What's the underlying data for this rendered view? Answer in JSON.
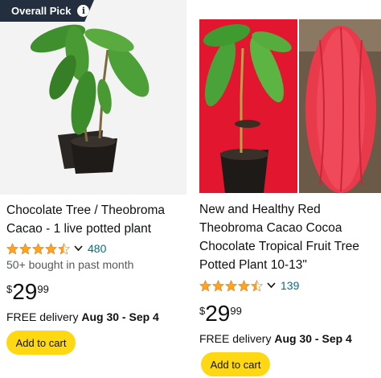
{
  "colors": {
    "badge_bg": "#232f3e",
    "star": "#ffa41c",
    "link": "#007185",
    "button": "#ffd814",
    "muted": "#565959"
  },
  "products": [
    {
      "badge": "Overall Pick",
      "badge_icon": "info-icon",
      "image_alt": "Theobroma cacao seedling in black pot",
      "title": "Chocolate Tree / Theobroma Cacao - 1 live potted plant",
      "rating": 4.5,
      "review_count": "480",
      "bought": "50+ bought in past month",
      "price_symbol": "$",
      "price_whole": "29",
      "price_fraction": "99",
      "delivery_prefix": "FREE delivery ",
      "delivery_dates": "Aug 30 - Sep 4",
      "cart_label": "Add to cart"
    },
    {
      "image_alt": "Potted cacao seedling on red background beside red cacao pod",
      "title": "New and Healthy Red Theobroma Cacao Cocoa Chocolate Tropical Fruit Tree Potted Plant 10-13\"",
      "rating": 4.5,
      "review_count": "139",
      "price_symbol": "$",
      "price_whole": "29",
      "price_fraction": "99",
      "delivery_prefix": "FREE delivery ",
      "delivery_dates": "Aug 30 - Sep 4",
      "cart_label": "Add to cart"
    }
  ]
}
